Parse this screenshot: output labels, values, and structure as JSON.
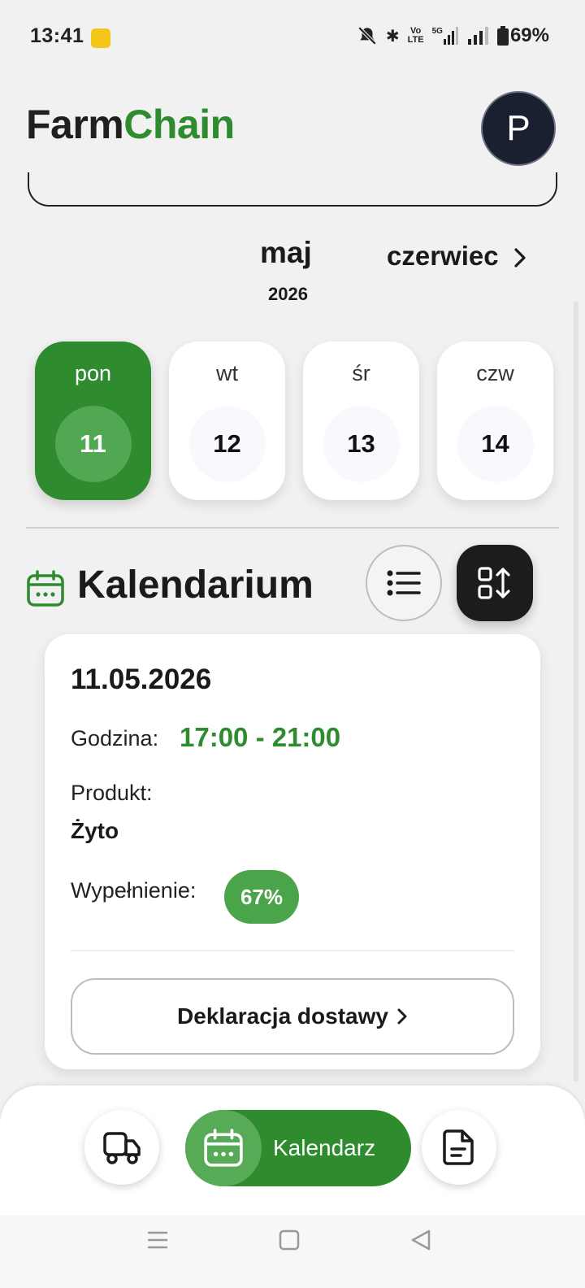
{
  "status_bar": {
    "time": "13:41",
    "battery": "69%",
    "icons": [
      "brightness-icon",
      "mute-icon",
      "bluetooth-icon",
      "volte-icon",
      "5g-signal-icon",
      "signal-icon",
      "battery-icon"
    ],
    "volte_top": "Vo",
    "volte_bottom": "LTE",
    "net": "5G"
  },
  "header": {
    "logo_part1": "Farm",
    "logo_part2": "Chain",
    "avatar_initial": "P"
  },
  "month_selector": {
    "current_month": "maj",
    "current_year": "2026",
    "next_month": "czerwiec"
  },
  "days": [
    {
      "name": "pon",
      "number": "11",
      "selected": true
    },
    {
      "name": "wt",
      "number": "12",
      "selected": false
    },
    {
      "name": "śr",
      "number": "13",
      "selected": false
    },
    {
      "name": "czw",
      "number": "14",
      "selected": false
    }
  ],
  "section": {
    "title": "Kalendarium"
  },
  "event": {
    "date": "11.05.2026",
    "hour_label": "Godzina:",
    "hour_value": "17:00 - 21:00",
    "product_label": "Produkt:",
    "product_value": "Żyto",
    "fill_label": "Wypełnienie:",
    "fill_value": "67%",
    "fill_fraction": 0.67,
    "declare_button": "Deklaracja dostawy"
  },
  "bottom_nav": {
    "calendar_label": "Kalendarz"
  },
  "colors": {
    "brand_green": "#2e8b2e",
    "light_green": "#52a852",
    "dark": "#1c1c1c",
    "avatar_bg": "#1b2030"
  }
}
